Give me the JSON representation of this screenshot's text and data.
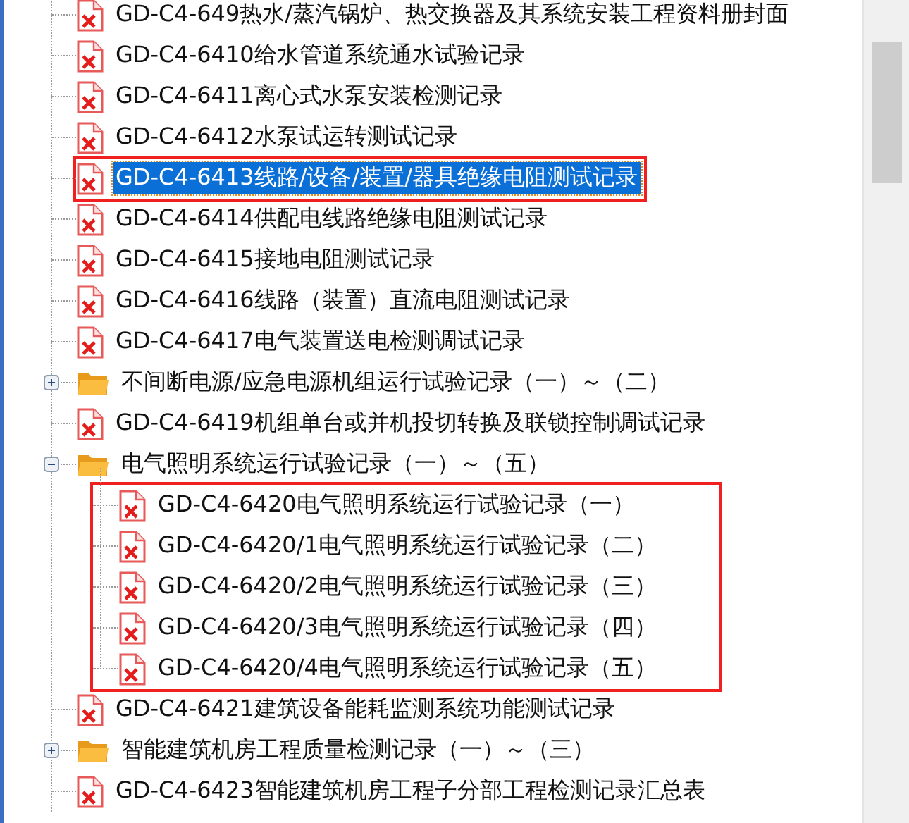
{
  "tree": {
    "items": [
      {
        "kind": "file",
        "label": "GD-C4-649热水/蒸汽锅炉、热交换器及其系统安装工程资料册封面",
        "selected": false,
        "marked": false
      },
      {
        "kind": "file",
        "label": "GD-C4-6410给水管道系统通水试验记录",
        "selected": false,
        "marked": false
      },
      {
        "kind": "file",
        "label": "GD-C4-6411离心式水泵安装检测记录",
        "selected": false,
        "marked": false
      },
      {
        "kind": "file",
        "label": "GD-C4-6412水泵试运转测试记录",
        "selected": false,
        "marked": false
      },
      {
        "kind": "file",
        "label": "GD-C4-6413线路/设备/装置/器具绝缘电阻测试记录",
        "selected": true,
        "marked": true
      },
      {
        "kind": "file",
        "label": "GD-C4-6414供配电线路绝缘电阻测试记录",
        "selected": false,
        "marked": false
      },
      {
        "kind": "file",
        "label": "GD-C4-6415接地电阻测试记录",
        "selected": false,
        "marked": false
      },
      {
        "kind": "file",
        "label": "GD-C4-6416线路（装置）直流电阻测试记录",
        "selected": false,
        "marked": false
      },
      {
        "kind": "file",
        "label": "GD-C4-6417电气装置送电检测调试记录",
        "selected": false,
        "marked": false
      },
      {
        "kind": "folder",
        "label": "不间断电源/应急电源机组运行试验记录（一）～（二）",
        "selected": false,
        "marked": false,
        "expanded": false
      },
      {
        "kind": "file",
        "label": "GD-C4-6419机组单台或并机投切转换及联锁控制调试记录",
        "selected": false,
        "marked": false
      },
      {
        "kind": "folder",
        "label": "电气照明系统运行试验记录（一）～（五）",
        "selected": false,
        "marked": false,
        "expanded": true,
        "children_marked": true,
        "children": [
          {
            "kind": "file",
            "label": "GD-C4-6420电气照明系统运行试验记录（一）",
            "selected": false,
            "marked": false
          },
          {
            "kind": "file",
            "label": "GD-C4-6420/1电气照明系统运行试验记录（二）",
            "selected": false,
            "marked": false
          },
          {
            "kind": "file",
            "label": "GD-C4-6420/2电气照明系统运行试验记录（三）",
            "selected": false,
            "marked": false
          },
          {
            "kind": "file",
            "label": "GD-C4-6420/3电气照明系统运行试验记录（四）",
            "selected": false,
            "marked": false
          },
          {
            "kind": "file",
            "label": "GD-C4-6420/4电气照明系统运行试验记录（五）",
            "selected": false,
            "marked": false
          }
        ]
      },
      {
        "kind": "file",
        "label": "GD-C4-6421建筑设备能耗监测系统功能测试记录",
        "selected": false,
        "marked": false
      },
      {
        "kind": "folder",
        "label": "智能建筑机房工程质量检测记录（一）～（三）",
        "selected": false,
        "marked": false,
        "expanded": false
      },
      {
        "kind": "file",
        "label": "GD-C4-6423智能建筑机房工程子分部工程检测记录汇总表",
        "selected": false,
        "marked": false
      }
    ]
  }
}
